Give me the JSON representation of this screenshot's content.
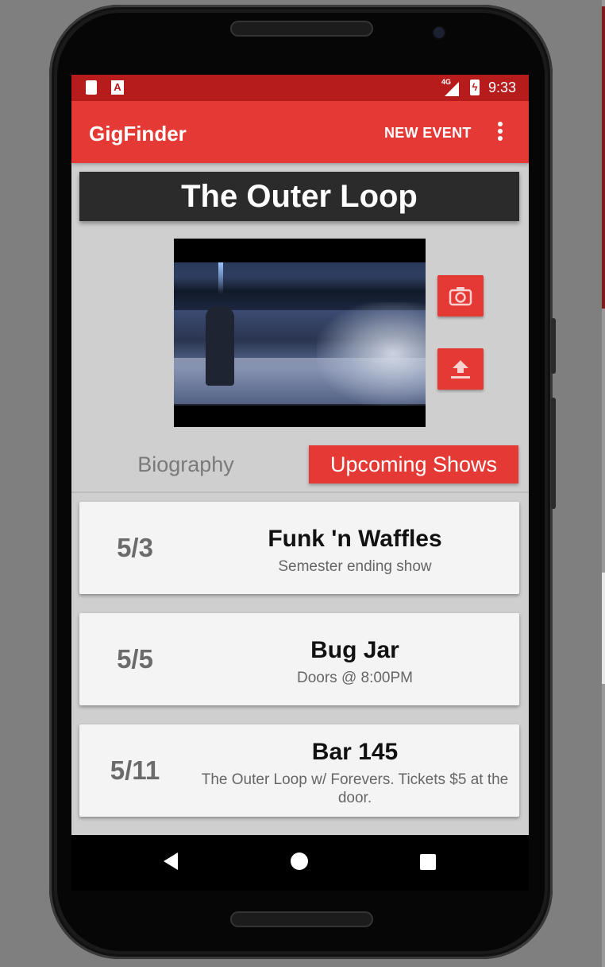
{
  "status_bar": {
    "network": "4G",
    "time": "9:33"
  },
  "app_bar": {
    "title": "GigFinder",
    "new_event_label": "NEW EVENT",
    "overflow_icon": "more-vert-icon"
  },
  "band": {
    "name": "The Outer Loop"
  },
  "actions": {
    "camera_icon": "camera-icon",
    "upload_icon": "upload-icon"
  },
  "tabs": [
    {
      "label": "Biography",
      "active": false
    },
    {
      "label": "Upcoming Shows",
      "active": true
    }
  ],
  "shows": [
    {
      "date": "5/3",
      "venue": "Funk 'n Waffles",
      "description": "Semester ending show"
    },
    {
      "date": "5/5",
      "venue": "Bug Jar",
      "description": "Doors @ 8:00PM"
    },
    {
      "date": "5/11",
      "venue": "Bar 145",
      "description": "The Outer Loop w/ Forevers. Tickets $5 at the door."
    }
  ],
  "colors": {
    "accent": "#e53935",
    "status_bar": "#b71c1c",
    "title_bg": "#2b2b2b"
  }
}
